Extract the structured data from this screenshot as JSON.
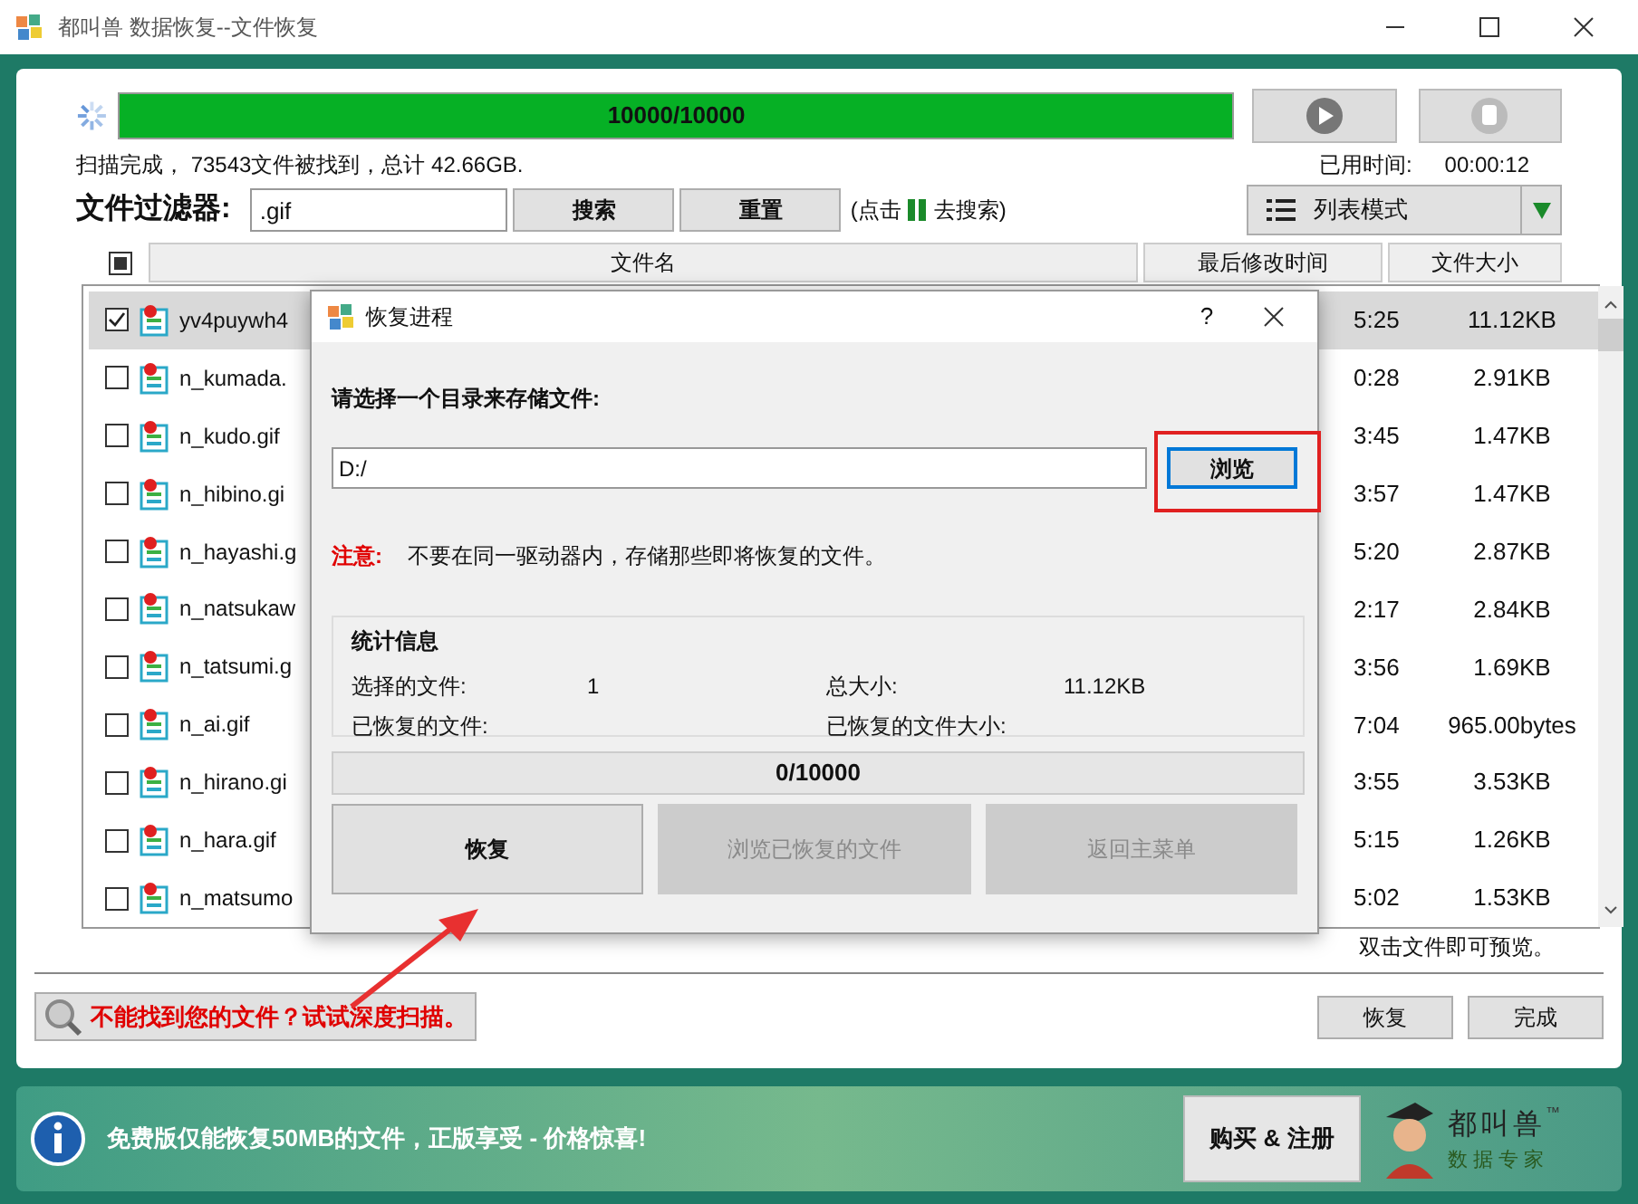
{
  "window": {
    "title": "都叫兽 数据恢复--文件恢复"
  },
  "scan": {
    "progress": {
      "label": "10000/10000",
      "level": 1
    },
    "status": "扫描完成， 73543文件被找到，总计 42.66GB.",
    "elapsed_label": "已用时间:",
    "elapsed": "00:00:12"
  },
  "filter": {
    "label": "文件过滤器:",
    "value": ".gif",
    "search_button": "搜索",
    "reset_button": "重置",
    "hint_before": "(点击",
    "hint_after": "去搜索)"
  },
  "view_mode": {
    "label": "列表模式"
  },
  "table": {
    "all_partial": true,
    "columns": [
      "文件名",
      "最后修改时间",
      "文件大小"
    ],
    "rows": [
      {
        "name": "yv4puywh4",
        "time": "5:25",
        "size": "11.12KB",
        "checked": true,
        "selected": true
      },
      {
        "name": "n_kumada.",
        "time": "0:28",
        "size": "2.91KB",
        "checked": false,
        "selected": false
      },
      {
        "name": "n_kudo.gif",
        "time": "3:45",
        "size": "1.47KB",
        "checked": false,
        "selected": false
      },
      {
        "name": "n_hibino.gi",
        "time": "3:57",
        "size": "1.47KB",
        "checked": false,
        "selected": false
      },
      {
        "name": "n_hayashi.g",
        "time": "5:20",
        "size": "2.87KB",
        "checked": false,
        "selected": false
      },
      {
        "name": "n_natsukaw",
        "time": "2:17",
        "size": "2.84KB",
        "checked": false,
        "selected": false
      },
      {
        "name": "n_tatsumi.g",
        "time": "3:56",
        "size": "1.69KB",
        "checked": false,
        "selected": false
      },
      {
        "name": "n_ai.gif",
        "time": "7:04",
        "size": "965.00bytes",
        "checked": false,
        "selected": false
      },
      {
        "name": "n_hirano.gi",
        "time": "3:55",
        "size": "3.53KB",
        "checked": false,
        "selected": false
      },
      {
        "name": "n_hara.gif",
        "time": "5:15",
        "size": "1.26KB",
        "checked": false,
        "selected": false
      },
      {
        "name": "n_matsumo",
        "time": "5:02",
        "size": "1.53KB",
        "checked": false,
        "selected": false
      }
    ],
    "hint": "双击文件即可预览。"
  },
  "deep_scan": {
    "label": "不能找到您的文件？试试深度扫描。"
  },
  "actions": [
    "恢复",
    "完成"
  ],
  "banner": {
    "message": "免费版仅能恢复50MB的文件，正版享受 - 价格惊喜!",
    "buy_button": "购买 & 注册",
    "logo_text": "都叫兽",
    "logo_sub": "数据专家",
    "logo_mark": "™"
  },
  "dialog": {
    "title": "恢复进程",
    "help": "?",
    "prompt": "请选择一个目录来存储文件:",
    "path": "D:/",
    "browse": "浏览",
    "note_label": "注意:",
    "note": "不要在同一驱动器内，存储那些即将恢复的文件。",
    "stats": {
      "title": "统计信息",
      "items": [
        {
          "label": "选择的文件:",
          "value": "1"
        },
        {
          "label": "总大小:",
          "value": "11.12KB"
        },
        {
          "label": "已恢复的文件:"
        },
        {
          "label": "已恢复的文件大小:"
        }
      ]
    },
    "progress": {
      "label": "0/10000",
      "level": 0
    },
    "buttons": [
      {
        "label": "恢复",
        "disabled": false
      },
      {
        "label": "浏览已恢复的文件",
        "disabled": true
      },
      {
        "label": "返回主菜单",
        "disabled": true
      }
    ]
  }
}
